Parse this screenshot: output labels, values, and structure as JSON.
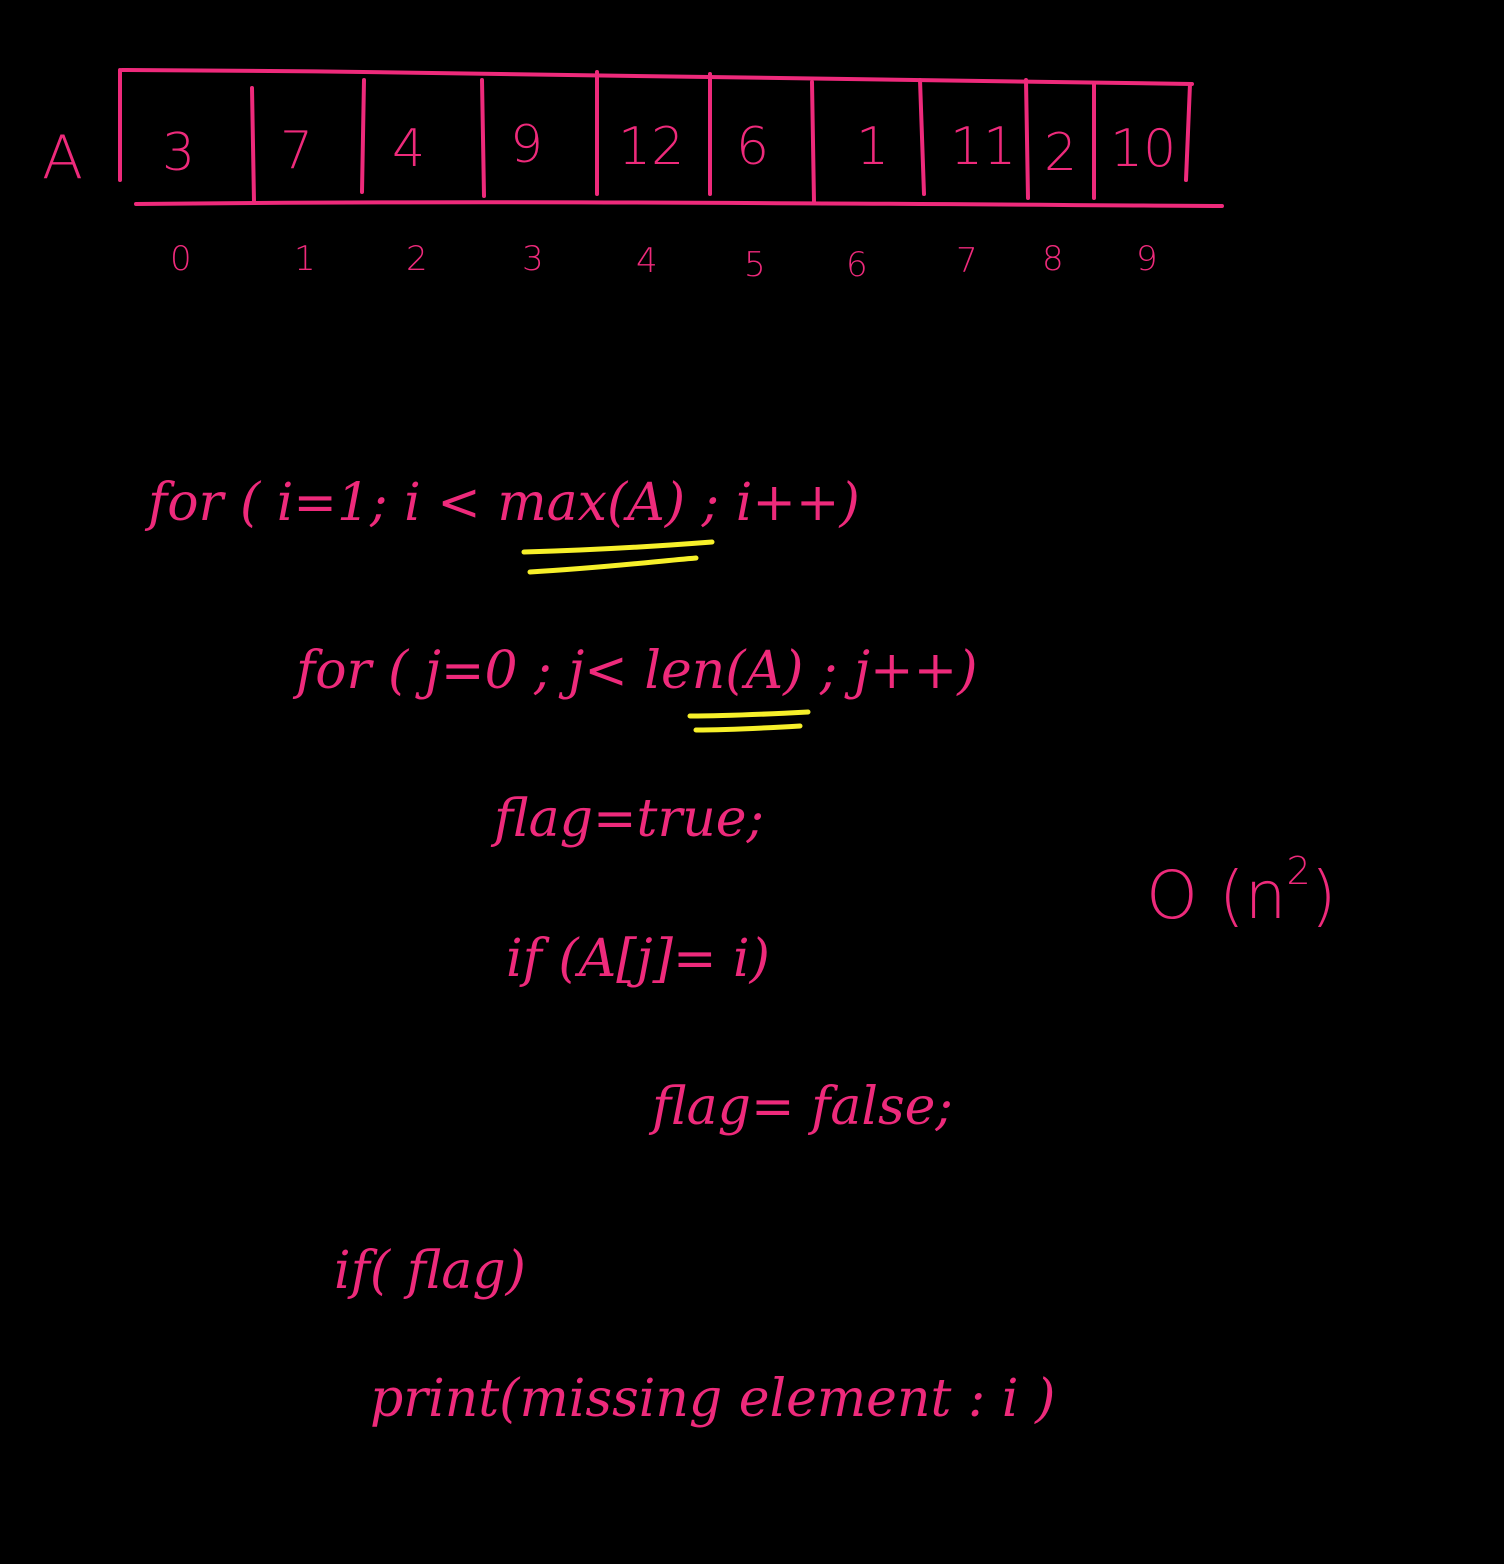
{
  "array": {
    "name": "A",
    "values": [
      "3",
      "7",
      "4",
      "9",
      "12",
      "6",
      "1",
      "11",
      "2",
      "10"
    ],
    "indices": [
      "0",
      "1",
      "2",
      "3",
      "4",
      "5",
      "6",
      "7",
      "8",
      "9"
    ]
  },
  "code": {
    "line1": "for ( i=1; i < max(A) ; i++)",
    "line2": "for ( j=0 ; j< len(A) ; j++)",
    "line3": "flag=true;",
    "line4": "if (A[j]= i)",
    "line5": "flag= false;",
    "line6": "if( flag)",
    "line7": "print(missing element : i )"
  },
  "complexity": {
    "base": "O (n",
    "exponent": "2",
    "close": ")"
  },
  "colors": {
    "background": "#000000",
    "ink": "#ee2a7b",
    "highlight": "#f7f02a"
  }
}
